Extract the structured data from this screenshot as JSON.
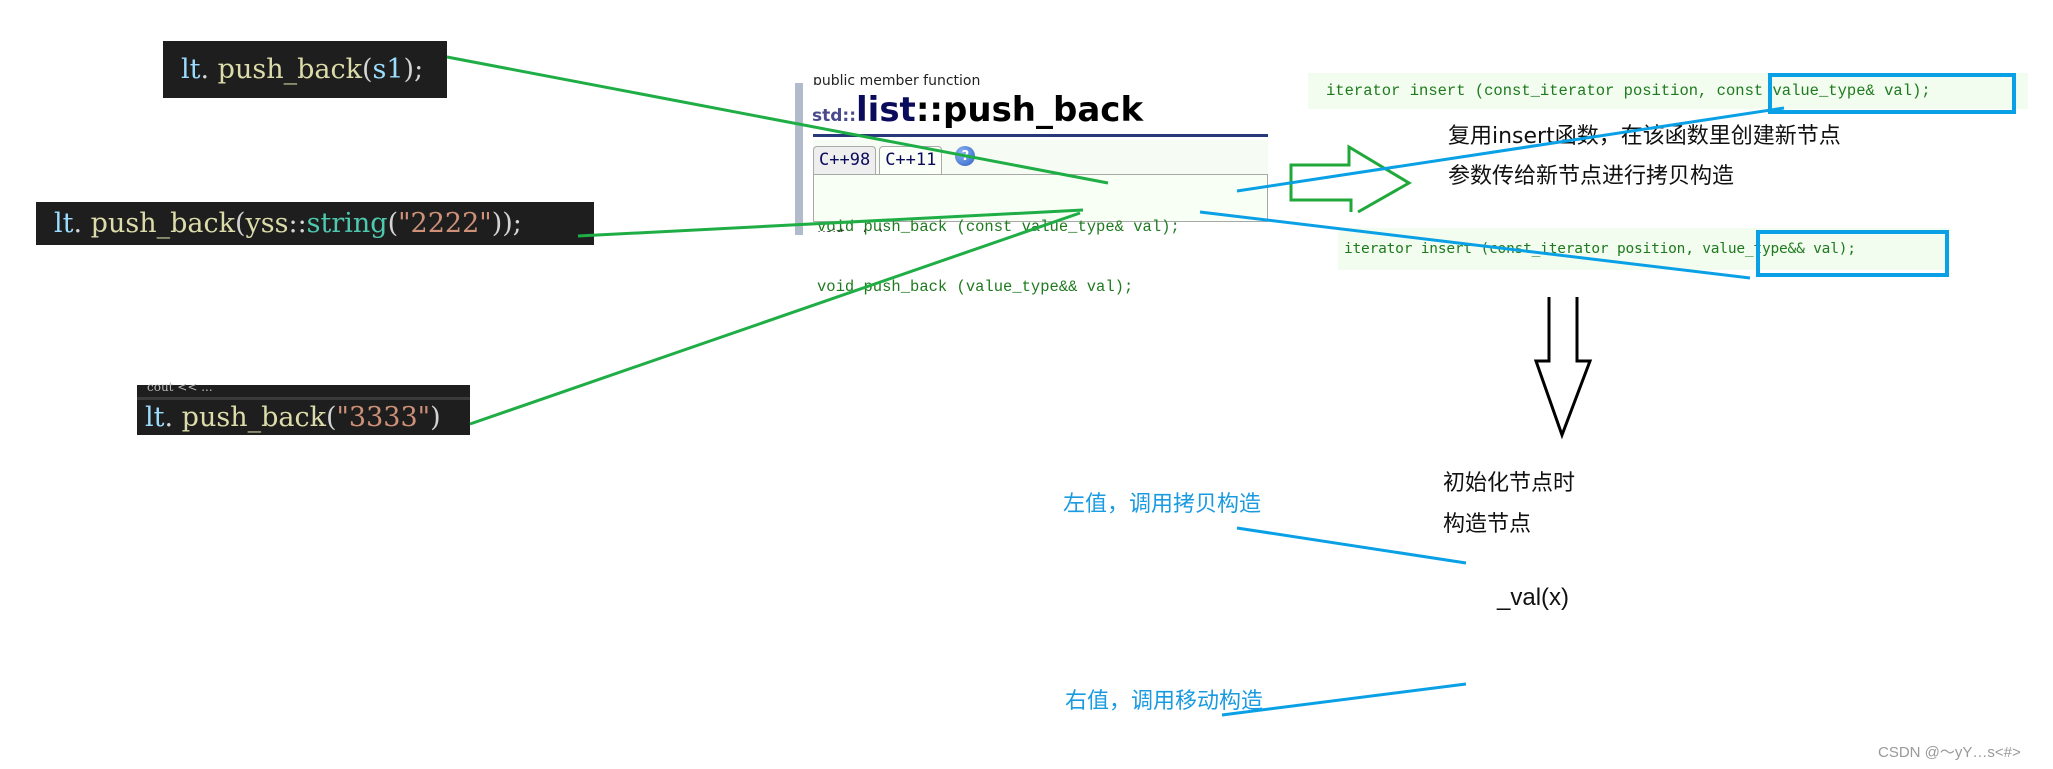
{
  "snippets": [
    {
      "id": "push_back_lvalue",
      "tokens": [
        {
          "text": "lt",
          "kind": "ident"
        },
        {
          "text": ". ",
          "kind": "punct"
        },
        {
          "text": "push_back",
          "kind": "fn"
        },
        {
          "text": "(",
          "kind": "punct"
        },
        {
          "text": "s1",
          "kind": "ident"
        },
        {
          "text": ")",
          "kind": "punct"
        },
        {
          "text": ";",
          "kind": "punct"
        }
      ]
    },
    {
      "id": "push_back_temp_object",
      "tokens": [
        {
          "text": "lt",
          "kind": "ident"
        },
        {
          "text": ". ",
          "kind": "punct"
        },
        {
          "text": "push_back",
          "kind": "fn"
        },
        {
          "text": "(",
          "kind": "punct"
        },
        {
          "text": "yss",
          "kind": "fn"
        },
        {
          "text": "::",
          "kind": "punct"
        },
        {
          "text": "string",
          "kind": "type"
        },
        {
          "text": "(",
          "kind": "punct"
        },
        {
          "text": "\"2222\"",
          "kind": "str"
        },
        {
          "text": "))",
          "kind": "punct"
        },
        {
          "text": ";",
          "kind": "punct"
        }
      ]
    },
    {
      "id": "push_back_literal",
      "top_cut_text": "cout << ...",
      "tokens": [
        {
          "text": "lt",
          "kind": "ident"
        },
        {
          "text": ". ",
          "kind": "punct"
        },
        {
          "text": "push_back",
          "kind": "fn"
        },
        {
          "text": "(",
          "kind": "punct"
        },
        {
          "text": "\"3333\"",
          "kind": "str"
        },
        {
          "text": ")",
          "kind": "punct"
        }
      ]
    }
  ],
  "doc": {
    "kicker": "public member function",
    "title_ns": "std::",
    "title_class": "list",
    "title_fn": "::push_back",
    "tabs": [
      {
        "label": "C++98",
        "active": false
      },
      {
        "label": "C++11",
        "active": true
      }
    ],
    "help_icon_glyph": "?",
    "code_lines": [
      "void push_back (const value_type& val);",
      "void push_back (value_type&& val);"
    ],
    "cut_line": "void ... (...)"
  },
  "insert_signatures": [
    {
      "prefix": "iterator insert (const_iterator position, ",
      "highlighted": "const value_type& val)",
      "suffix": ";"
    },
    {
      "prefix": "iterator insert (const_iterator position, ",
      "highlighted": "value_type&& val);",
      "suffix": ""
    }
  ],
  "notes": {
    "reuse_insert_line1": "复用insert函数，在该函数里创建新节点",
    "reuse_insert_line2": "参数传给新节点进行拷贝构造",
    "init_node_line1": "初始化节点时",
    "init_node_line2": "构造节点",
    "val_init": "_val(x)",
    "lvalue_note": "左值，调用拷贝构造",
    "rvalue_note": "右值，调用移动构造"
  },
  "watermark": "CSDN @～yY…s<#>",
  "colors": {
    "connector_green": "#1fad45",
    "connector_blue": "#0aa0e6",
    "arrow_green": "#21a83a",
    "arrow_black": "#000000",
    "code_bg": "#1e1e1e"
  }
}
